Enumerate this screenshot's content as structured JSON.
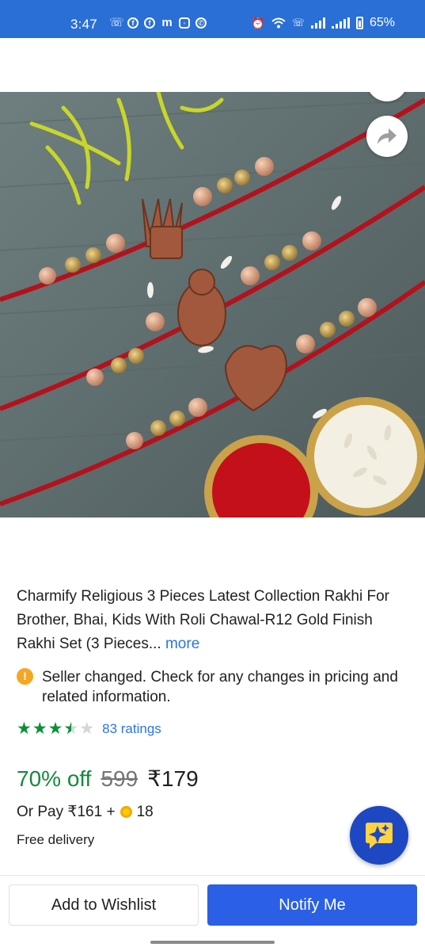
{
  "status_bar": {
    "time": "3:47",
    "battery": "65%",
    "left_icons": [
      "call-icon",
      "facebook-icon",
      "facebook-icon",
      "m-app-icon",
      "instagram-icon",
      "whatsapp-icon"
    ],
    "right_icons": [
      "alarm-icon",
      "wifi-icon",
      "vowifi-icon",
      "signal-icon",
      "signal-icon",
      "battery-icon"
    ]
  },
  "product": {
    "image_alt": "Rakhi set with roli and chawal bowls",
    "title": "Charmify Religious 3 Pieces Latest Collection Rakhi For Brother, Bhai, Kids With Roli Chawal-R12 Gold Finish Rakhi  Set (3 Pieces...",
    "more_label": "more",
    "notice": "Seller changed. Check for any changes in pricing and related information.",
    "rating_value": 3.5,
    "ratings_text": "83 ratings",
    "discount": "70% off",
    "mrp": "599",
    "price": "₹179",
    "or_pay_text": "Or Pay ₹161 +",
    "coins": "18",
    "delivery": "Free delivery"
  },
  "actions": {
    "add_to_wishlist": "Add to Wishlist",
    "notify_me": "Notify Me"
  },
  "colors": {
    "status_bar": "#2a6fd6",
    "primary_button": "#2a5fe6",
    "discount_green": "#138a3c",
    "link_blue": "#2874f0",
    "star_green": "#0d8f3a"
  }
}
